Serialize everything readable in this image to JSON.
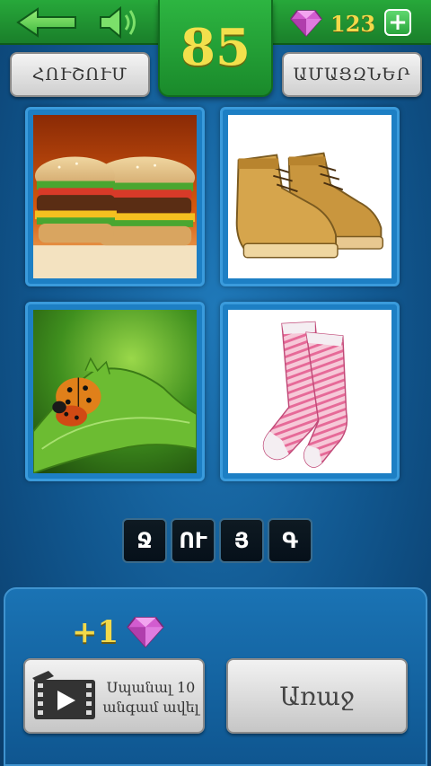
{
  "header": {
    "level": "85",
    "gem_count": "123",
    "left_button": "ՀՈՒՇՈՒՄ",
    "right_button": "ԱՄԱՑԶՆԵՐ"
  },
  "tiles": [
    {
      "subject": "hamburgers"
    },
    {
      "subject": "boots"
    },
    {
      "subject": "ladybug on leaf"
    },
    {
      "subject": "pink striped socks"
    }
  ],
  "answer": {
    "letters": [
      "Ջ",
      "ՈՒ",
      "Յ",
      "Գ"
    ]
  },
  "bottom": {
    "reward": "+1",
    "watch_video_label": "Սպանալ 10 անգամ ավել",
    "next_button": "Առաջ"
  },
  "colors": {
    "topbar": "#1f9a33",
    "gold": "#f2e04c",
    "gem": "#d25ccf"
  }
}
